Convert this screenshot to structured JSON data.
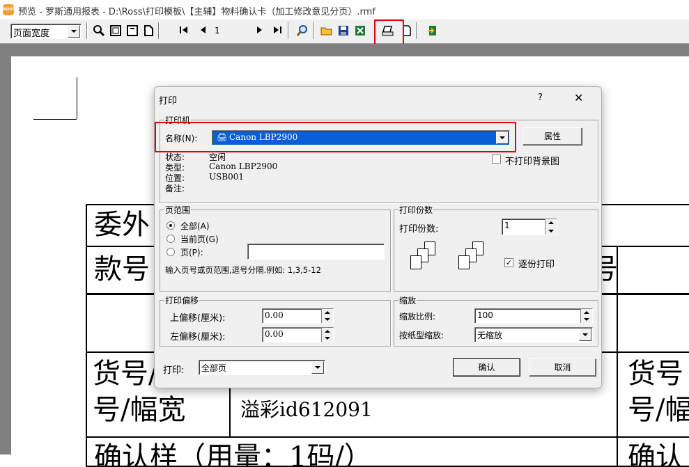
{
  "window": {
    "app_icon_text": "ROSS",
    "title": "预览 - 罗斯通用报表 - D:\\Ross\\打印模板\\【主辅】物料确认卡（加工修改意见分页）.rmf"
  },
  "toolbar": {
    "zoom_select": "页面宽度",
    "page_number": "1",
    "icons": [
      "zoom-icon",
      "one-page-icon",
      "two-page-icon",
      "page-icon",
      "first-page-icon",
      "prev-page-icon",
      "next-page-icon",
      "last-page-icon",
      "find-icon",
      "open-icon",
      "save-icon",
      "excel-icon",
      "print-icon",
      "new-page-icon",
      "exit-icon"
    ]
  },
  "report": {
    "cells": {
      "r1_left": "委外",
      "r2_left": "款号",
      "r2_right": "号",
      "r4_left": "货号/色",
      "r4_left_b": "号/幅宽",
      "r4_mid": "溢彩id612091",
      "r4_right": "货号",
      "r4_right_b": "号/幅",
      "r5_left": "确认样（用量：1码/）",
      "r5_right": "确认"
    }
  },
  "dialog": {
    "title": "打印",
    "help": "?",
    "close": "✕",
    "printer": {
      "group_label": "打印机",
      "name_label": "名称(N):",
      "name_value": "Canon LBP2900",
      "properties_button": "属性",
      "status_label": "状态:",
      "status_value": "空闲",
      "type_label": "类型:",
      "type_value": "Canon LBP2900",
      "location_label": "位置:",
      "location_value": "USB001",
      "comment_label": "备注:",
      "no_background_label": "不打印背景图",
      "no_background_checked": false
    },
    "page_range": {
      "group_label": "页范围",
      "all_label": "全部(A)",
      "current_label": "当前页(G)",
      "pages_label": "页(P):",
      "pages_value": "",
      "hint": "输入页号或页范围,逗号分隔.例如: 1,3,5-12",
      "selected": "all"
    },
    "copies": {
      "group_label": "打印份数",
      "copies_label": "打印份数:",
      "copies_value": "1",
      "collate_label": "逐份打印",
      "collate_checked": true
    },
    "offset": {
      "group_label": "打印偏移",
      "top_label": "上偏移(厘米):",
      "top_value": "0.00",
      "left_label": "左偏移(厘米):",
      "left_value": "0.00"
    },
    "scale": {
      "group_label": "缩放",
      "ratio_label": "缩放比例:",
      "ratio_value": "100",
      "paper_scale_label": "按纸型缩放:",
      "paper_scale_value": "无缩放"
    },
    "print_label": "打印:",
    "print_value": "全部页",
    "ok_button": "确认",
    "cancel_button": "取消"
  },
  "highlight_color": "#e00000"
}
